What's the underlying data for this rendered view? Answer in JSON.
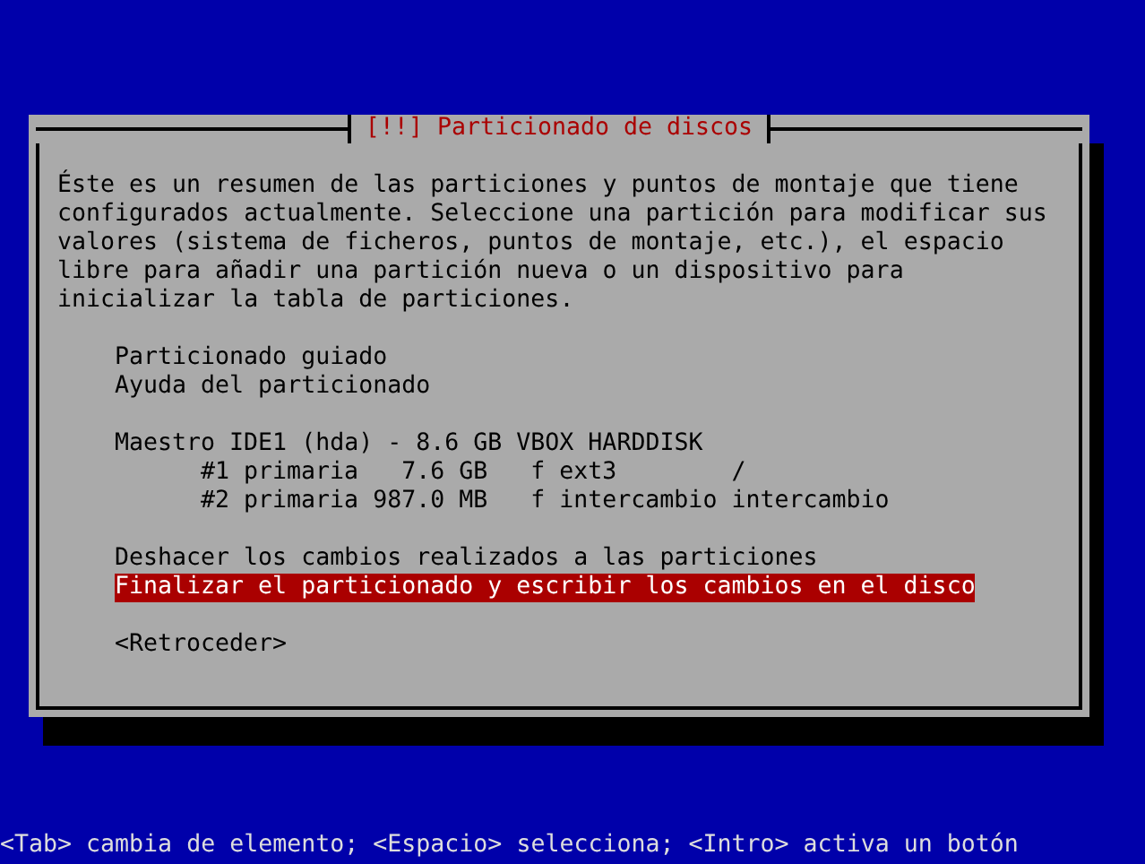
{
  "dialog": {
    "title": "[!!] Particionado de discos",
    "description": "Éste es un resumen de las particiones y puntos de montaje que tiene configurados actualmente. Seleccione una partición para modificar sus valores (sistema de ficheros, puntos de montaje, etc.), el espacio libre para añadir una partición nueva o un dispositivo para inicializar la tabla de particiones.",
    "menu_groups": [
      [
        {
          "label": "Particionado guiado",
          "selected": false
        },
        {
          "label": "Ayuda del particionado",
          "selected": false
        }
      ],
      [
        {
          "label": "Maestro IDE1 (hda) - 8.6 GB VBOX HARDDISK",
          "selected": false,
          "children": [
            {
              "label": "#1 primaria   7.6 GB   f ext3        /",
              "selected": false
            },
            {
              "label": "#2 primaria 987.0 MB   f intercambio intercambio",
              "selected": false
            }
          ]
        }
      ],
      [
        {
          "label": "Deshacer los cambios realizados a las particiones",
          "selected": false
        },
        {
          "label": "Finalizar el particionado y escribir los cambios en el disco",
          "selected": true
        }
      ]
    ],
    "back_button": "<Retroceder>"
  },
  "help_line": "<Tab> cambia de elemento; <Espacio> selecciona; <Intro> activa un botón"
}
